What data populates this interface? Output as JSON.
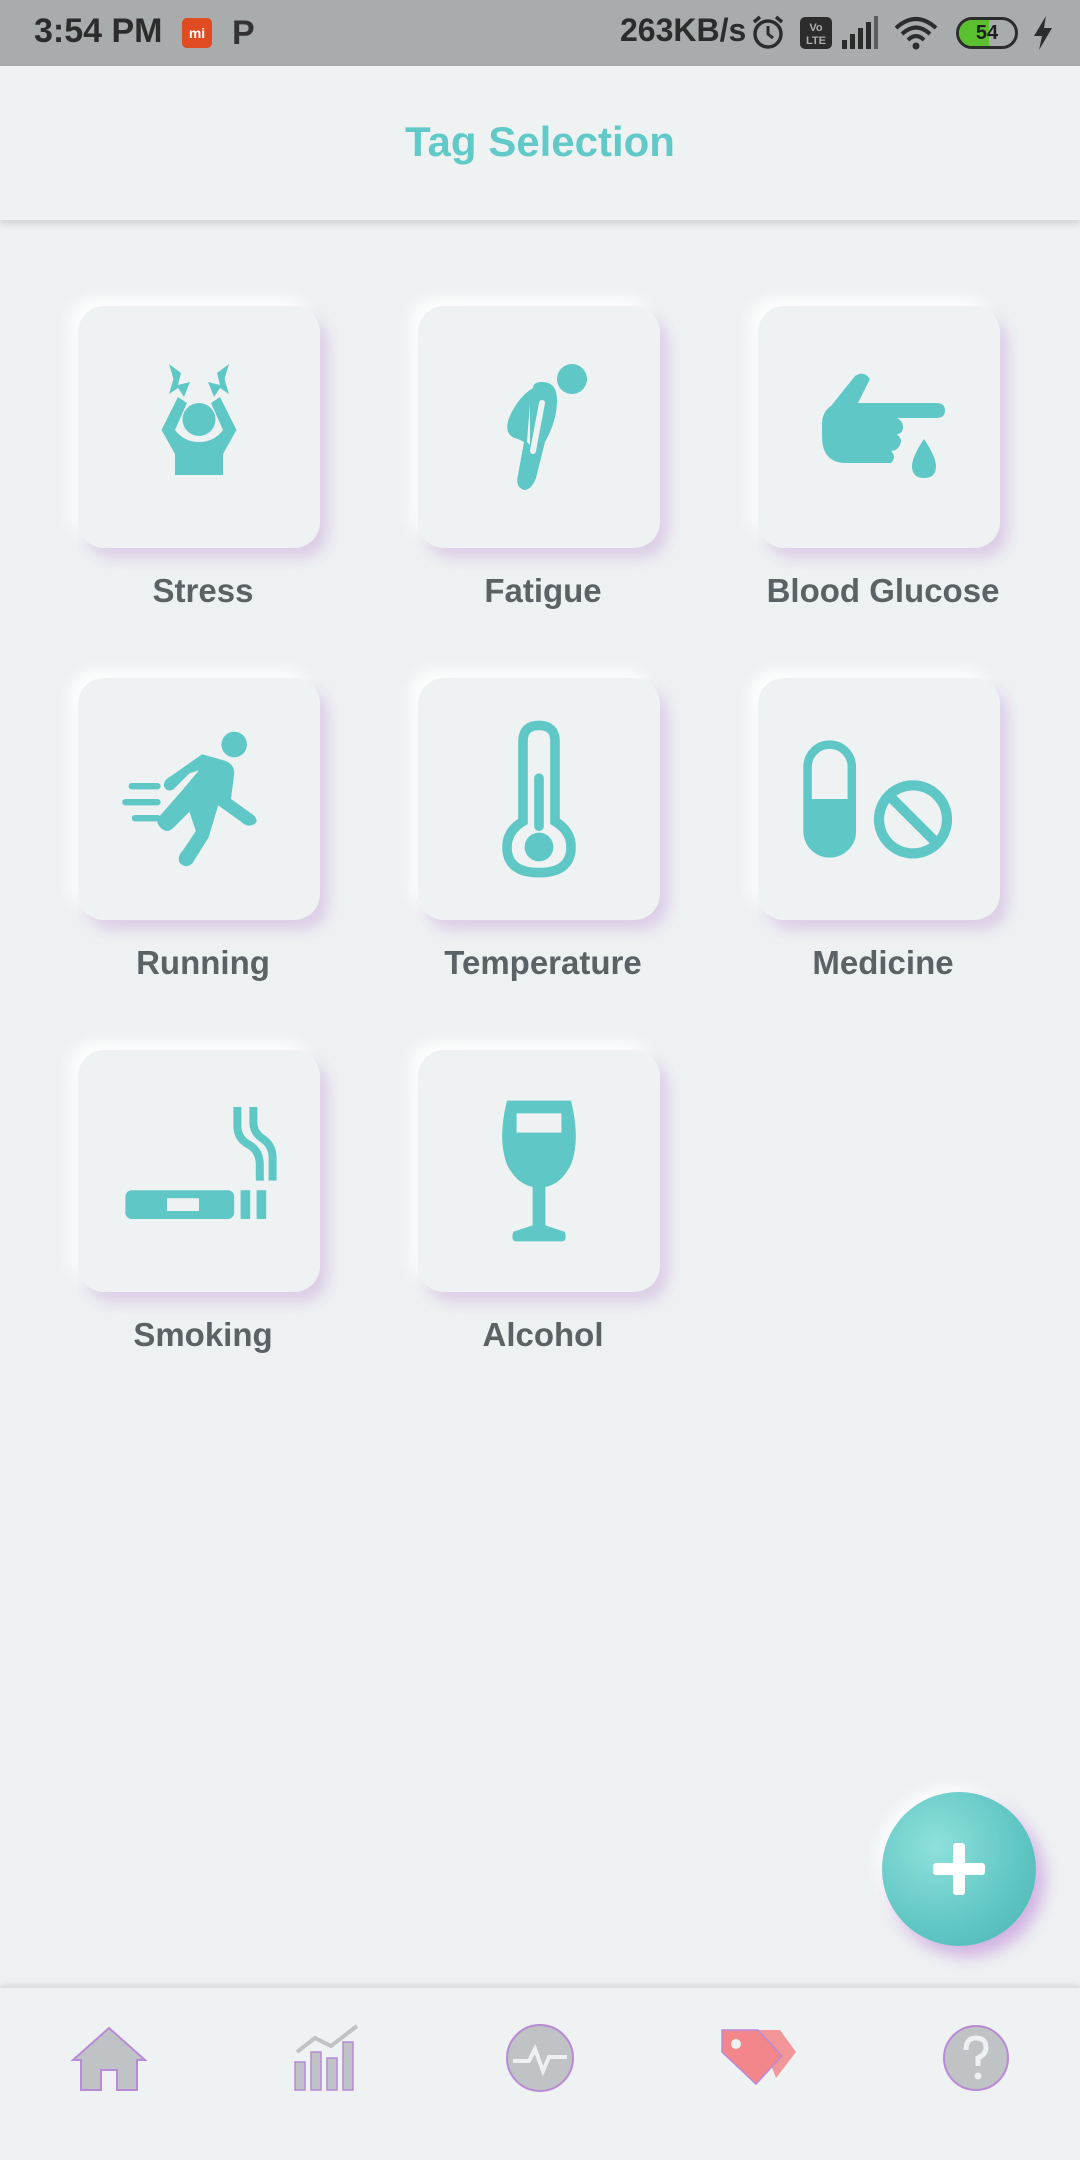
{
  "status_bar": {
    "time": "3:54 PM",
    "notification_icons": [
      "mi-icon",
      "p-icon"
    ],
    "network_speed": "263KB/s",
    "battery_level": "54"
  },
  "header": {
    "title": "Tag Selection"
  },
  "tags": [
    {
      "label": "Stress",
      "icon": "stress-icon"
    },
    {
      "label": "Fatigue",
      "icon": "fatigue-icon"
    },
    {
      "label": "Blood Glucose",
      "icon": "blood-glucose-icon"
    },
    {
      "label": "Running",
      "icon": "running-icon"
    },
    {
      "label": "Temperature",
      "icon": "thermometer-icon"
    },
    {
      "label": "Medicine",
      "icon": "medicine-icon"
    },
    {
      "label": "Smoking",
      "icon": "smoking-icon"
    },
    {
      "label": "Alcohol",
      "icon": "wine-glass-icon"
    }
  ],
  "fab": {
    "icon": "plus-icon"
  },
  "bottom_nav": [
    {
      "icon": "home-icon",
      "active": false
    },
    {
      "icon": "chart-icon",
      "active": false
    },
    {
      "icon": "heartbeat-icon",
      "active": false
    },
    {
      "icon": "tags-icon",
      "active": true
    },
    {
      "icon": "help-icon",
      "active": false
    }
  ],
  "colors": {
    "accent": "#62c9c9",
    "icon_teal": "#5fc8c6",
    "label_gray": "#5b6266",
    "active_nav": "#f2868a",
    "inactive_nav": "#bfc3c5",
    "nav_shadow": "#b98bd6"
  }
}
